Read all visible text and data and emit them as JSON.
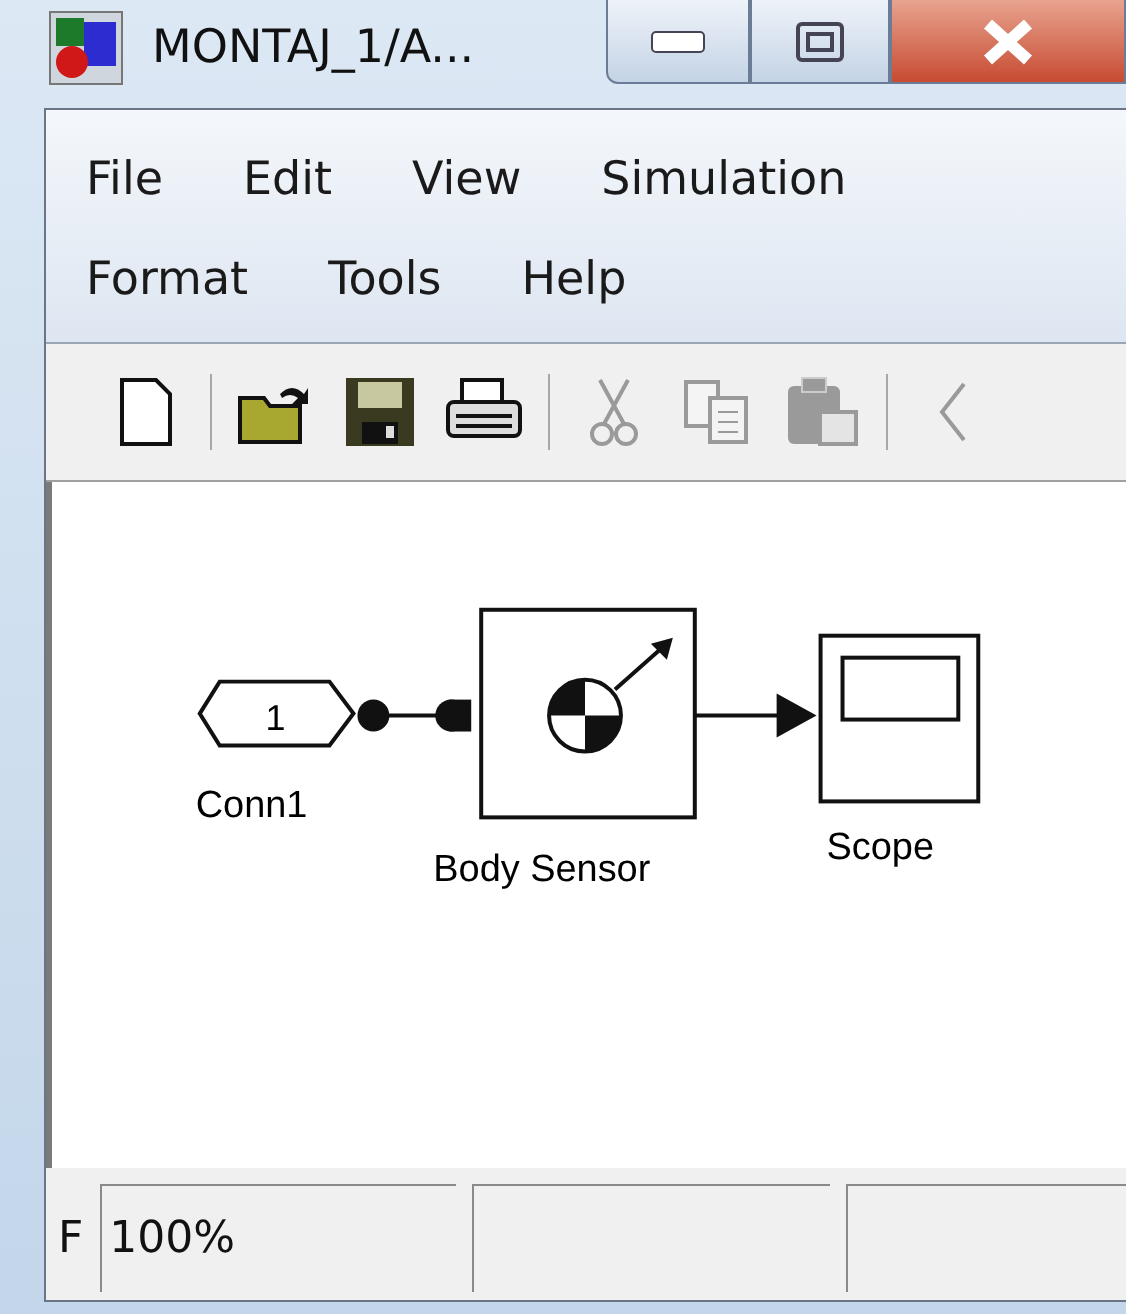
{
  "window": {
    "title": "MONTAJ_1/A..."
  },
  "menu_rows": [
    [
      "File",
      "Edit",
      "View",
      "Simulation"
    ],
    [
      "Format",
      "Tools",
      "Help"
    ]
  ],
  "toolbar": [
    {
      "kind": "new",
      "disabled": false
    },
    {
      "kind": "separator"
    },
    {
      "kind": "open",
      "disabled": false
    },
    {
      "kind": "save",
      "disabled": false
    },
    {
      "kind": "print",
      "disabled": false
    },
    {
      "kind": "separator"
    },
    {
      "kind": "cut",
      "disabled": true
    },
    {
      "kind": "copy",
      "disabled": true
    },
    {
      "kind": "paste",
      "disabled": true
    },
    {
      "kind": "separator"
    },
    {
      "kind": "back",
      "disabled": true
    }
  ],
  "diagram": {
    "connector": {
      "number": "1",
      "label": "Conn1"
    },
    "sensor": {
      "label": "Body Sensor"
    },
    "scope": {
      "label": "Scope"
    }
  },
  "status_bar": {
    "cut_text": "F",
    "zoom": "100%"
  }
}
